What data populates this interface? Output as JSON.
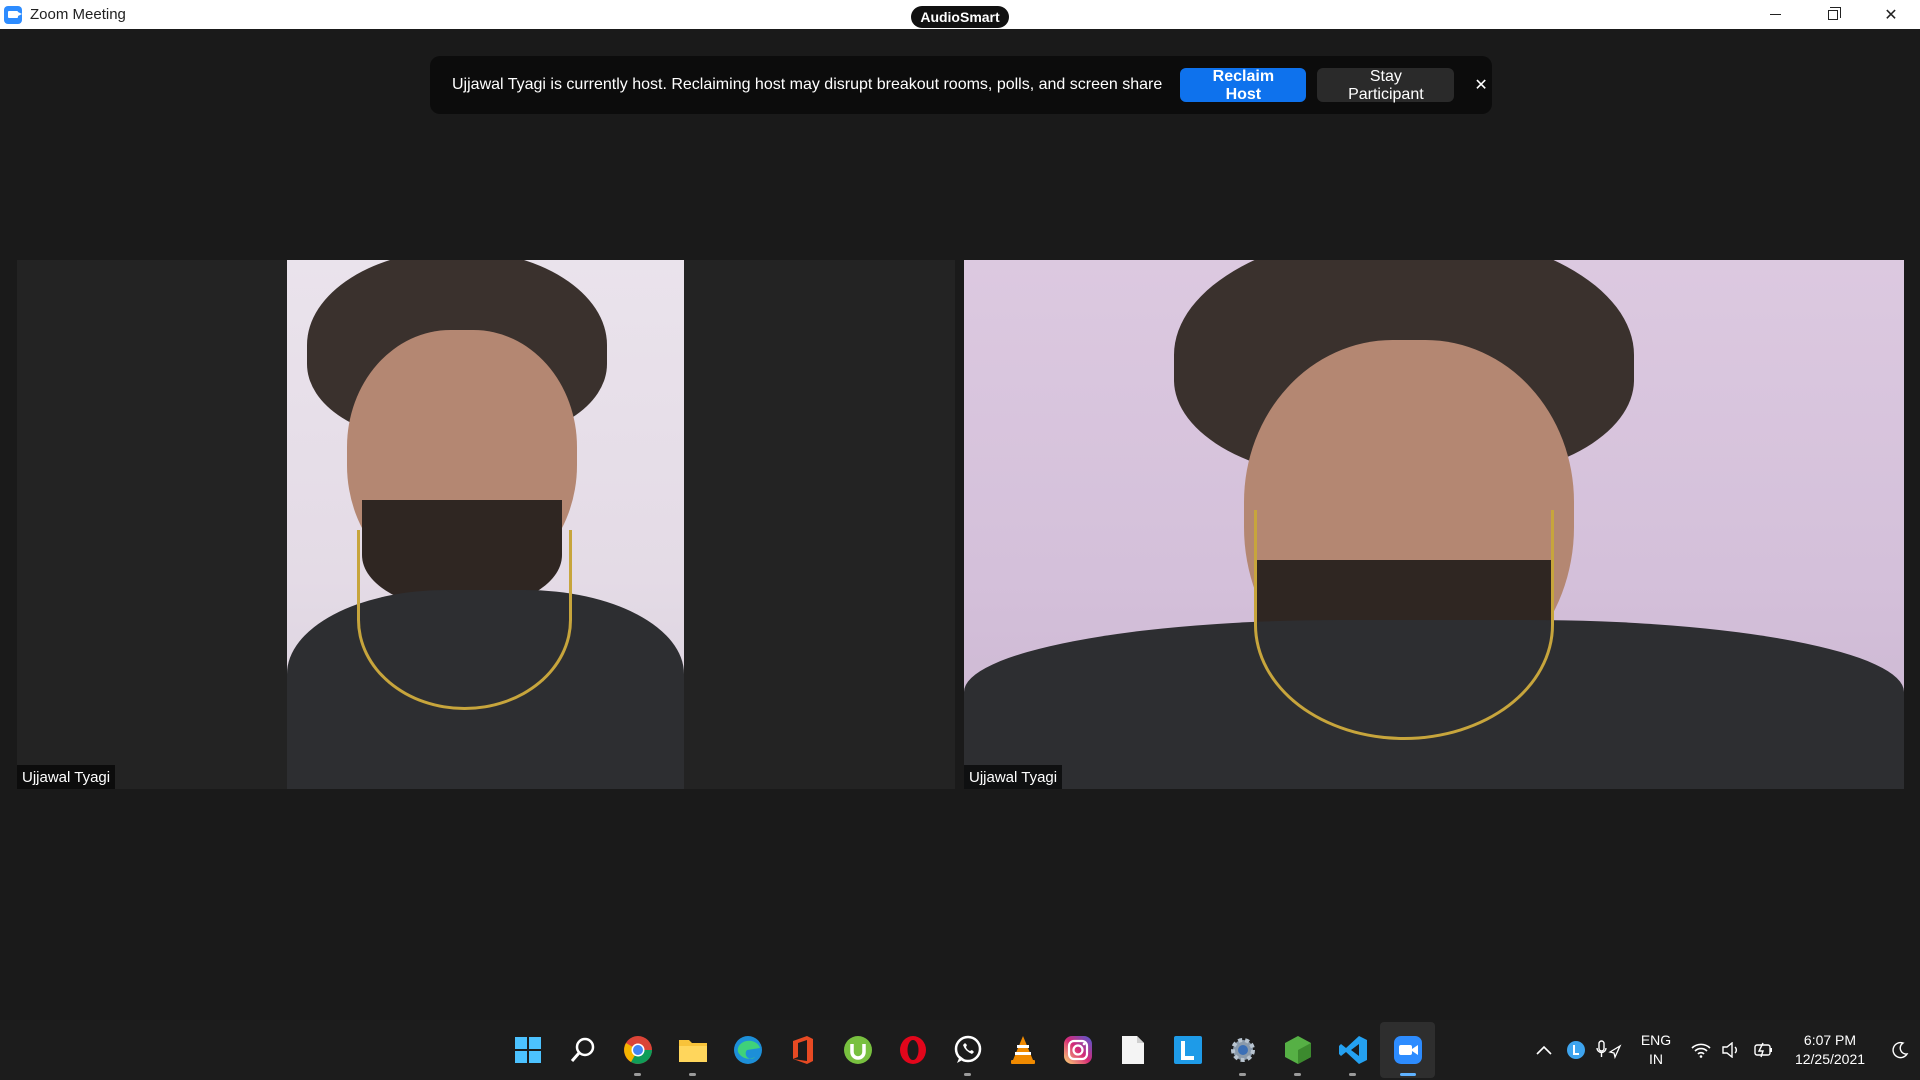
{
  "window": {
    "title": "Zoom Meeting",
    "audio_badge": "AudioSmart",
    "controls": {
      "minimize": "—",
      "restore": "❐",
      "close": "✕"
    }
  },
  "banner": {
    "message": "Ujjawal Tyagi is currently host. Reclaiming host may disrupt breakout rooms, polls, and screen share",
    "reclaim_label": "Reclaim Host",
    "stay_label": "Stay Participant",
    "close_glyph": "✕"
  },
  "tiles": [
    {
      "name": "Ujjawal Tyagi"
    },
    {
      "name": "Ujjawal Tyagi"
    }
  ],
  "taskbar": {
    "apps": [
      {
        "name": "windows-start-icon"
      },
      {
        "name": "search-icon"
      },
      {
        "name": "chrome-icon"
      },
      {
        "name": "file-explorer-icon"
      },
      {
        "name": "edge-icon"
      },
      {
        "name": "office-icon"
      },
      {
        "name": "utorrent-icon"
      },
      {
        "name": "opera-icon"
      },
      {
        "name": "whatsapp-icon"
      },
      {
        "name": "vlc-icon"
      },
      {
        "name": "instagram-icon"
      },
      {
        "name": "notepad-icon"
      },
      {
        "name": "l-app-icon"
      },
      {
        "name": "settings-icon"
      },
      {
        "name": "green-cube-app-icon"
      },
      {
        "name": "vscode-icon"
      },
      {
        "name": "zoom-icon"
      }
    ],
    "tray": {
      "language_top": "ENG",
      "language_bottom": "IN",
      "time": "6:07 PM",
      "date": "12/25/2021"
    }
  },
  "colors": {
    "accent_blue": "#0e72ed",
    "background": "#1a1a1a",
    "banner_bg": "#0c0c0c"
  }
}
